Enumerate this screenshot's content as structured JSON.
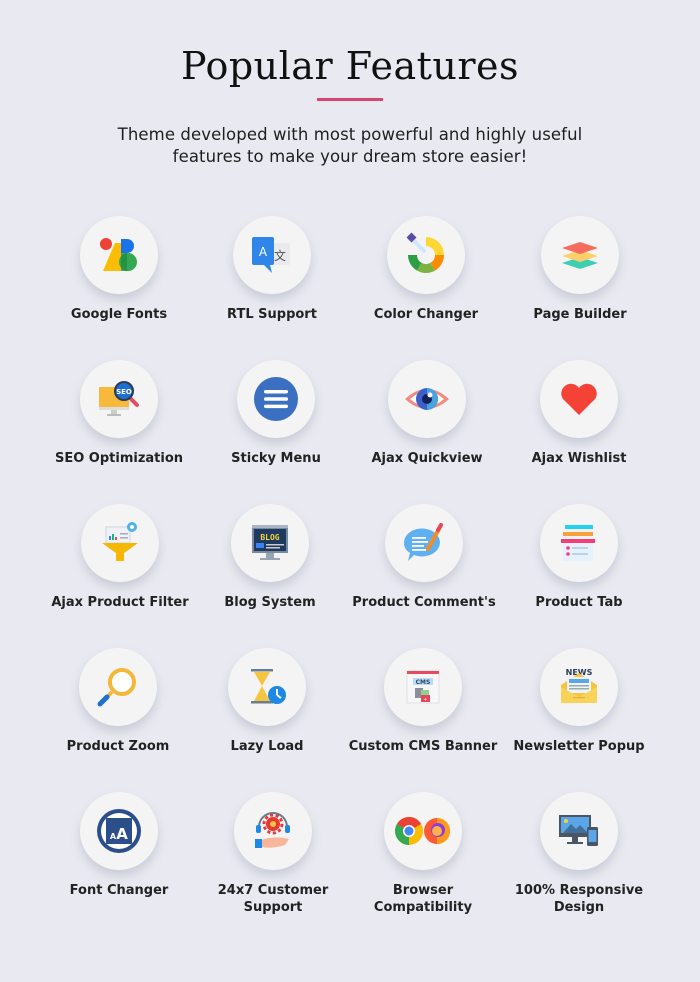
{
  "header": {
    "title": "Popular Features",
    "accent_color": "#d8466f",
    "subtitle_line1": "Theme developed with most powerful and highly useful",
    "subtitle_line2": "features to make your dream store easier!"
  },
  "features": [
    {
      "label": "Google Fonts",
      "icon": "google-fonts-icon"
    },
    {
      "label": "RTL Support",
      "icon": "translate-icon"
    },
    {
      "label": "Color Changer",
      "icon": "color-picker-icon"
    },
    {
      "label": "Page Builder",
      "icon": "layers-icon"
    },
    {
      "label": "SEO Optimization",
      "icon": "seo-monitor-icon"
    },
    {
      "label": "Sticky Menu",
      "icon": "hamburger-menu-icon"
    },
    {
      "label": "Ajax Quickview",
      "icon": "eye-icon"
    },
    {
      "label": "Ajax Wishlist",
      "icon": "heart-icon"
    },
    {
      "label": "Ajax Product Filter",
      "icon": "funnel-filter-icon"
    },
    {
      "label": "Blog System",
      "icon": "blog-monitor-icon"
    },
    {
      "label": "Product Comment's",
      "icon": "comment-pencil-icon"
    },
    {
      "label": "Product Tab",
      "icon": "tabs-icon"
    },
    {
      "label": "Product Zoom",
      "icon": "magnifier-icon"
    },
    {
      "label": "Lazy Load",
      "icon": "hourglass-clock-icon"
    },
    {
      "label": "Custom CMS Banner",
      "icon": "cms-banner-icon"
    },
    {
      "label": "Newsletter Popup",
      "icon": "news-envelope-icon"
    },
    {
      "label": "Font Changer",
      "icon": "font-size-icon"
    },
    {
      "label": "24x7 Customer Support",
      "label_line1": "24x7 Customer",
      "label_line2": "Support",
      "icon": "support-headset-icon"
    },
    {
      "label": "Browser Compatibility",
      "label_line1": "Browser",
      "label_line2": "Compatibility",
      "icon": "browsers-icon"
    },
    {
      "label": "100% Responsive Design",
      "label_line1": "100% Responsive",
      "label_line2": "Design",
      "icon": "responsive-devices-icon"
    }
  ],
  "cms_text": "CMS",
  "news_text": "NEWS",
  "blog_text": "BLOG"
}
